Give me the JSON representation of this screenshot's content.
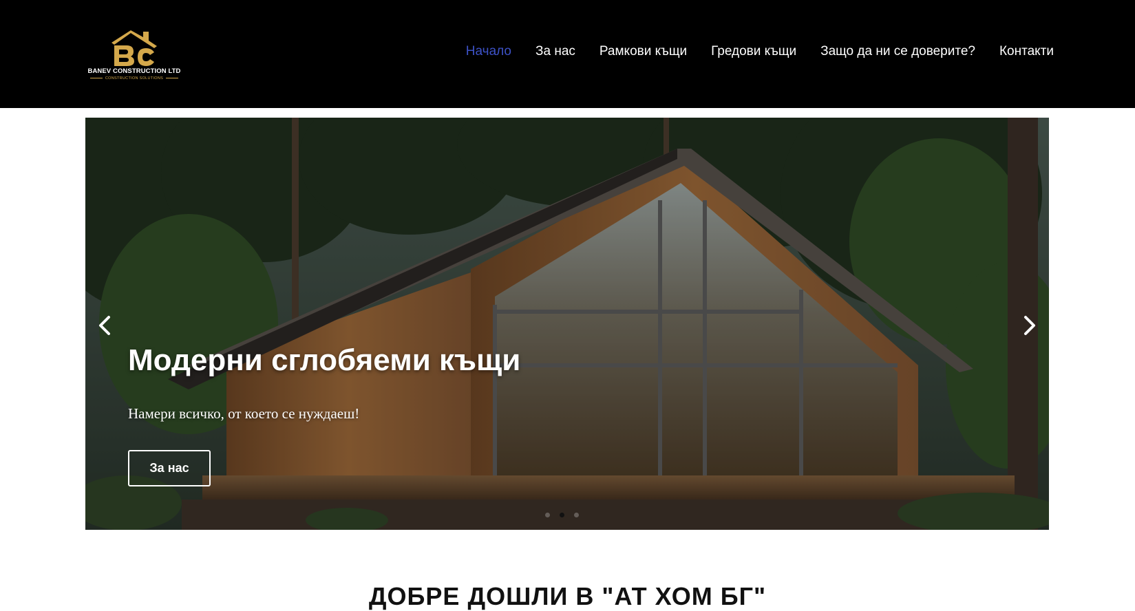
{
  "brand": {
    "name": "BANEV CONSTRUCTION LTD",
    "tagline": "CONSTRUCTION SOLUTIONS",
    "logo_color": "#d4a84b"
  },
  "nav": {
    "items": [
      {
        "label": "Начало",
        "active": true
      },
      {
        "label": "За нас"
      },
      {
        "label": "Рамкови къщи"
      },
      {
        "label": "Гредови къщи"
      },
      {
        "label": "Защо да ни се доверите?"
      },
      {
        "label": "Контакти"
      }
    ],
    "active_color": "#3d52c7"
  },
  "hero": {
    "title": "Модерни сглобяеми къщи",
    "subtitle": "Намери всичко, от което се нуждаеш!",
    "button_label": "За нас",
    "prev_icon": "chevron-left-icon",
    "next_icon": "chevron-right-icon",
    "slide_count": 3,
    "active_slide": 2
  },
  "section": {
    "heading": "ДОБРЕ ДОШЛИ В \"АТ ХОМ БГ\""
  }
}
